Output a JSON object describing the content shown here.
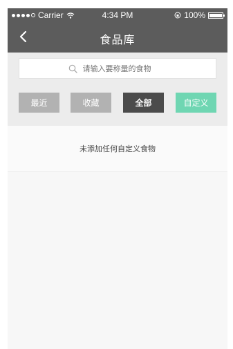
{
  "status_bar": {
    "carrier": "Carrier",
    "time": "4:34 PM",
    "battery": "100%"
  },
  "nav": {
    "title": "食品库"
  },
  "search": {
    "placeholder": "请输入要称量的食物"
  },
  "tabs": {
    "recent": "最近",
    "favorite": "收藏",
    "all": "全部",
    "custom": "自定义"
  },
  "list": {
    "empty_message": "未添加任何自定义食物"
  },
  "colors": {
    "nav_bg": "#5c5c5c",
    "tab_inactive": "#b2b2b2",
    "tab_active": "#4b4b4b",
    "accent": "#6fd6b2"
  },
  "icons": {
    "back": "chevron-left-icon",
    "search": "search-icon",
    "wifi": "wifi-icon",
    "lock": "orientation-lock-icon",
    "battery": "battery-icon",
    "signal": "signal-dots-icon"
  }
}
